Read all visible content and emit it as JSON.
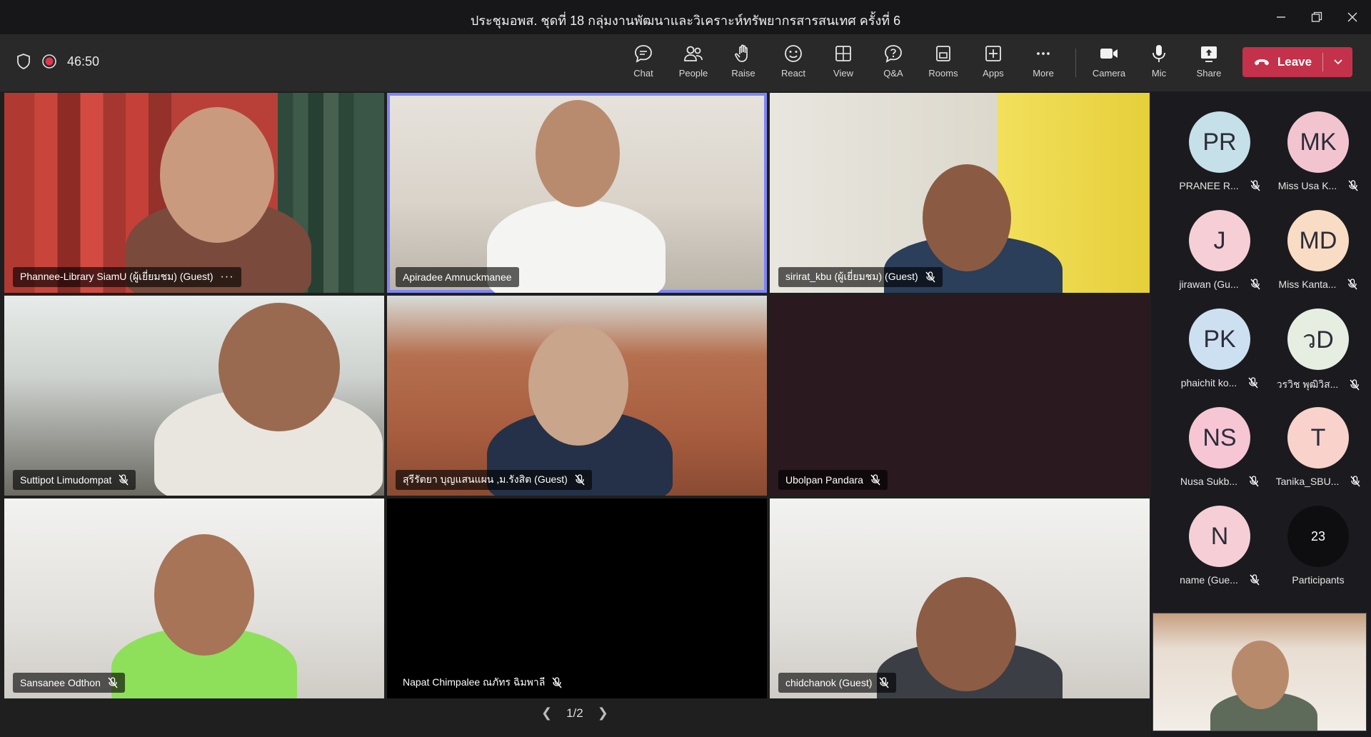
{
  "window": {
    "title": "ประชุมอพส. ชุดที่ 18 กลุ่มงานพัฒนาและวิเคราะห์ทรัพยากรสารสนเทศ ครั้งที่ 6"
  },
  "toolbar": {
    "timer": "46:50",
    "buttons": {
      "chat": "Chat",
      "people": "People",
      "raise": "Raise",
      "react": "React",
      "view": "View",
      "qa": "Q&A",
      "rooms": "Rooms",
      "apps": "Apps",
      "more": "More",
      "camera": "Camera",
      "mic": "Mic",
      "share": "Share"
    },
    "leave_label": "Leave"
  },
  "tiles": [
    {
      "name": "Phannee-Library SiamU (ผู้เยี่ยมชม) (Guest)",
      "muted": false
    },
    {
      "name": "Apiradee Amnuckmanee",
      "muted": false
    },
    {
      "name": "sirirat_kbu (ผู้เยี่ยมชม) (Guest)",
      "muted": true
    },
    {
      "name": "Suttipot Limudompat",
      "muted": true
    },
    {
      "name": "สุรีรัตยา บุญแสนแผน ,ม.รังสิต (Guest)",
      "muted": true
    },
    {
      "name": "Ubolpan Pandara",
      "muted": true
    },
    {
      "name": "Sansanee Odthon",
      "muted": true
    },
    {
      "name": "Napat Chimpalee ณภัทร ฉิมพาลี",
      "muted": true
    },
    {
      "name": "chidchanok (Guest)",
      "muted": true
    }
  ],
  "pager": {
    "label": "1/2"
  },
  "roster": [
    {
      "initials": "PR",
      "name": "PRANEE R...",
      "color": "#c5e0e8"
    },
    {
      "initials": "MK",
      "name": "Miss Usa K...",
      "color": "#f2c4d0"
    },
    {
      "initials": "J",
      "name": "jirawan (Gu...",
      "color": "#f6cfd6"
    },
    {
      "initials": "MD",
      "name": "Miss Kanta...",
      "color": "#f9dcc4"
    },
    {
      "initials": "PK",
      "name": "phaichit ko...",
      "color": "#cde0f2"
    },
    {
      "initials": "วD",
      "name": "วรวิช พุฒิวิส...",
      "color": "#e6eee2"
    },
    {
      "initials": "NS",
      "name": "Nusa Sukb...",
      "color": "#f6c6d4"
    },
    {
      "initials": "T",
      "name": "Tanika_SBU...",
      "color": "#f9d2cc"
    },
    {
      "initials": "N",
      "name": "name (Gue...",
      "color": "#f6cfd6"
    }
  ],
  "participants": {
    "count": "23",
    "label": "Participants"
  },
  "colors": {
    "leave_red": "#c4314b",
    "active_border": "#7f85f5"
  }
}
